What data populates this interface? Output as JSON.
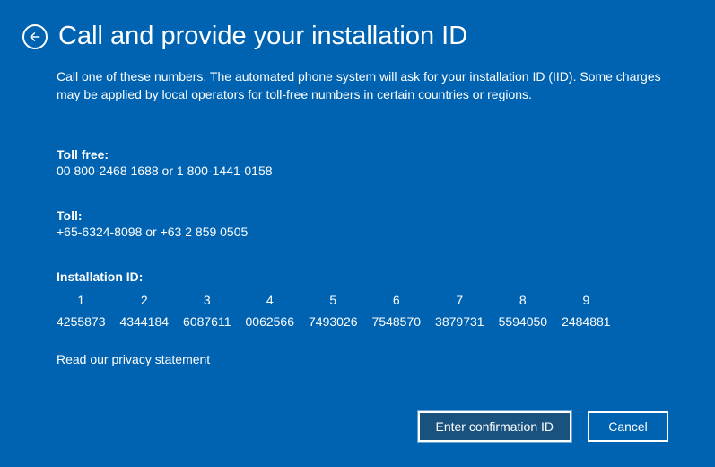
{
  "header": {
    "title": "Call and provide your installation ID"
  },
  "intro": "Call one of these numbers. The automated phone system will ask for your installation ID (IID). Some charges may be applied by local operators for toll-free numbers in certain countries or regions.",
  "tollfree": {
    "label": "Toll free:",
    "value": "00 800-2468 1688 or 1 800-1441-0158"
  },
  "toll": {
    "label": "Toll:",
    "value": "+65-6324-8098 or +63 2 859 0505"
  },
  "iid": {
    "label": "Installation ID:",
    "groups": [
      {
        "index": "1",
        "value": "4255873"
      },
      {
        "index": "2",
        "value": "4344184"
      },
      {
        "index": "3",
        "value": "6087611"
      },
      {
        "index": "4",
        "value": "0062566"
      },
      {
        "index": "5",
        "value": "7493026"
      },
      {
        "index": "6",
        "value": "7548570"
      },
      {
        "index": "7",
        "value": "3879731"
      },
      {
        "index": "8",
        "value": "5594050"
      },
      {
        "index": "9",
        "value": "2484881"
      }
    ]
  },
  "privacy": "Read our privacy statement",
  "buttons": {
    "enter": "Enter confirmation ID",
    "cancel": "Cancel"
  }
}
